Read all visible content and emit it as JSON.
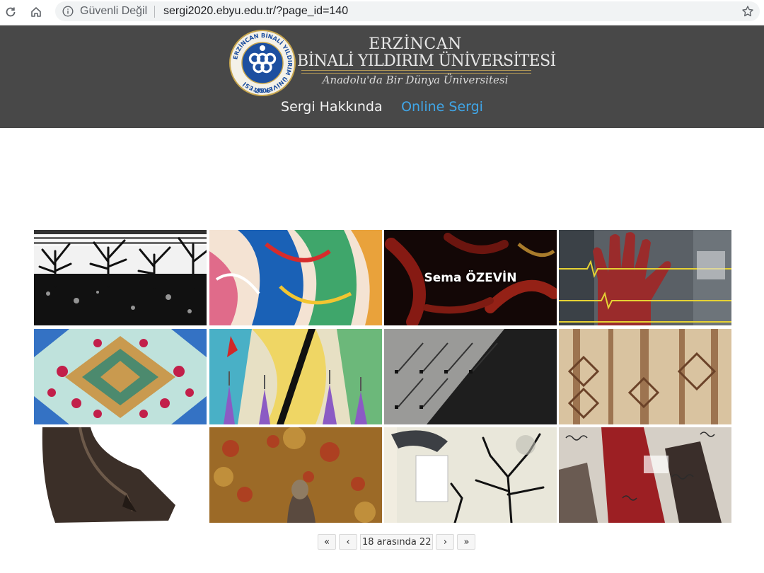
{
  "browser": {
    "security_label": "Güvenli Değil",
    "url": "sergi2020.ebyu.edu.tr/?page_id=140"
  },
  "header": {
    "logo_line1": "ERZİNCAN",
    "logo_line2": "BİNALİ YILDIRIM ÜNİVERSİTESİ",
    "logo_tagline": "Anadolu'da Bir Dünya Üniversitesi",
    "seal_ring_text": "ERZİNCAN BİNALİ YILDIRIM ÜNİVERSİTESİ",
    "seal_year": "2006",
    "background": "#484848"
  },
  "nav": {
    "about": "Sergi Hakkında",
    "online": "Online Sergi",
    "active_color": "#40a6e8"
  },
  "gallery": {
    "hover_caption": "Sema ÖZEVİN"
  },
  "pagination": {
    "first": "«",
    "prev": "‹",
    "info": "18 arasında 22",
    "next": "›",
    "last": "»"
  }
}
